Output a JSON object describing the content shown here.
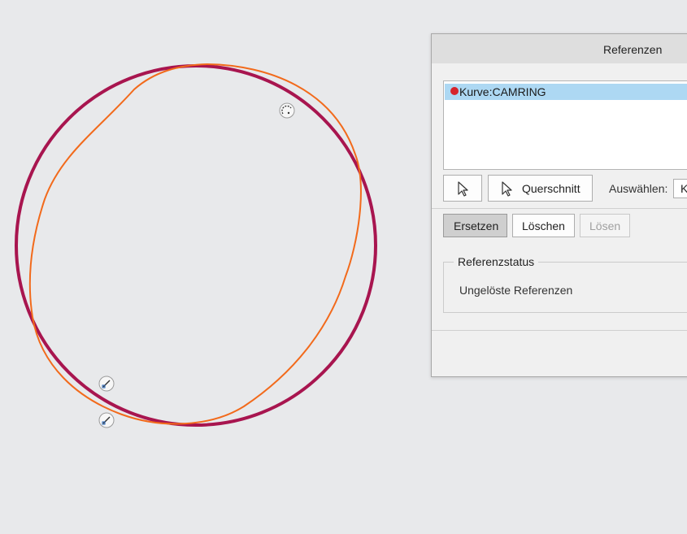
{
  "dialog": {
    "title": "Referenzen",
    "references": [
      {
        "label": "Kurve:CAMRING",
        "status_color": "#d6232b",
        "selected": true
      }
    ],
    "select_button_icon": "cursor-arrow-icon",
    "section_button_label": "Querschnitt",
    "section_button_icon": "cursor-arrow-icon",
    "filter_label": "Auswählen:",
    "filter_value": "K",
    "replace_label": "Ersetzen",
    "delete_label": "Löschen",
    "resolve_label": "Lösen",
    "status_group_title": "Referenzstatus",
    "status_text": "Ungelöste Referenzen"
  },
  "viewport": {
    "curve_colors": {
      "reference_circle": "#a8154f",
      "cam_profile": "#f26a1b"
    },
    "markers": [
      "dimension-arc-icon",
      "handle-icon",
      "handle-icon"
    ]
  }
}
